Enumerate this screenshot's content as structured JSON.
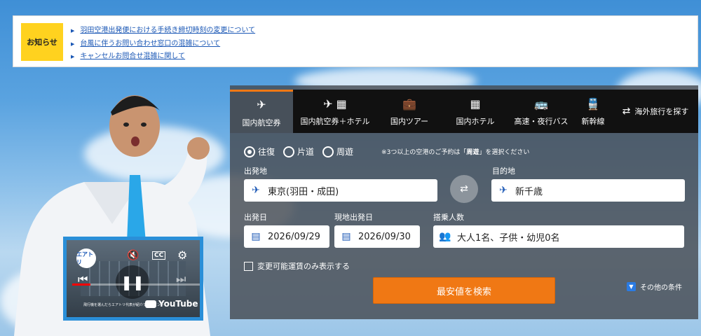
{
  "notice": {
    "badge": "お知らせ",
    "items": [
      "羽田空港出発便における手続き締切時刻の変更について",
      "台風に伴うお問い合わせ窓口の混雑について",
      "キャンセルお問合せ混雑に関して"
    ]
  },
  "video": {
    "badge": "エアトリ",
    "cc": "CC",
    "youtube": "YouTube",
    "caption": "飛行機を選んだらエアトリ代表が紹介するポイント",
    "progress": 0.14
  },
  "tabs": [
    {
      "label": "国内航空券",
      "icon": "plane-icon",
      "active": true
    },
    {
      "label": "国内航空券＋ホテル",
      "icon": "plane-hotel-icon",
      "active": false
    },
    {
      "label": "国内ツアー",
      "icon": "suitcase-icon",
      "active": false
    },
    {
      "label": "国内ホテル",
      "icon": "hotel-icon",
      "active": false
    },
    {
      "label": "高速・夜行バス",
      "icon": "bus-icon",
      "active": false
    },
    {
      "label": "新幹線",
      "icon": "train-icon",
      "active": false
    }
  ],
  "overseas_label": "海外旅行を探す",
  "trip_type": {
    "options": [
      "往復",
      "片道",
      "周遊"
    ],
    "selected": "往復",
    "note_prefix": "※3つ以上の空港のご予約は「",
    "note_bold": "周遊",
    "note_suffix": "」を選択ください"
  },
  "form": {
    "departure_label": "出発地",
    "departure_value": "東京(羽田・成田)",
    "destination_label": "目的地",
    "destination_value": "新千歳",
    "date_label": "出発日",
    "date_value": "2026/09/29",
    "local_date_label": "現地出発日",
    "local_date_value": "2026/09/30",
    "passengers_label": "搭乗人数",
    "passengers_value": "大人1名、子供・幼児0名"
  },
  "changeable_fare_label": "変更可能運賃のみ表示する",
  "search_button": "最安値を検索",
  "more_conditions": "その他の条件",
  "colors": {
    "accent": "#f07814",
    "tab_bar": "#111111",
    "notice_badge": "#ffd21f",
    "link": "#1a57b5"
  }
}
